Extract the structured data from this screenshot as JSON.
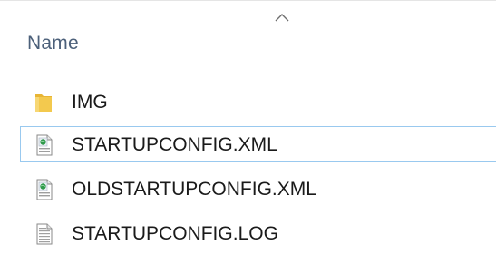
{
  "details_view": {
    "column_header": "Name",
    "sort_indicator": "chevron-up-icon",
    "colors": {
      "header_text": "#4c607a",
      "item_text": "#1a1a1a",
      "selection_border": "#99c9ef",
      "folder": "#f3c94e"
    },
    "items": [
      {
        "name": "IMG",
        "icon": "folder-icon",
        "selected": false
      },
      {
        "name": "STARTUPCONFIG.XML",
        "icon": "xml-file-icon",
        "selected": true
      },
      {
        "name": "OLDSTARTUPCONFIG.XML",
        "icon": "xml-file-icon",
        "selected": false
      },
      {
        "name": "STARTUPCONFIG.LOG",
        "icon": "text-file-icon",
        "selected": false
      }
    ]
  }
}
